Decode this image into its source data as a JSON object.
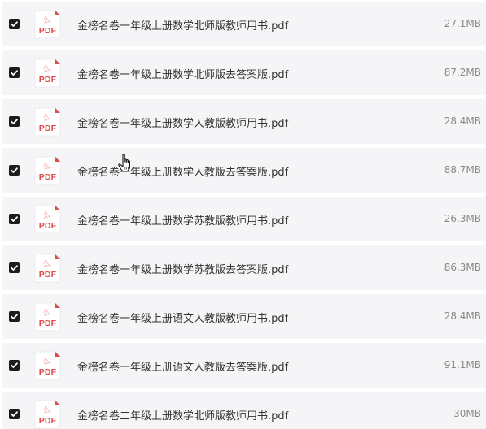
{
  "files": [
    {
      "name": "金榜名卷一年级上册数学北师版教师用书.pdf",
      "size": "27.1MB",
      "checked": true,
      "icon": "pdf-icon",
      "icon_label": "PDF"
    },
    {
      "name": "金榜名卷一年级上册数学北师版去答案版.pdf",
      "size": "87.2MB",
      "checked": true,
      "icon": "pdf-icon",
      "icon_label": "PDF"
    },
    {
      "name": "金榜名卷一年级上册数学人教版教师用书.pdf",
      "size": "28.4MB",
      "checked": true,
      "icon": "pdf-icon",
      "icon_label": "PDF"
    },
    {
      "name": "金榜名卷一年级上册数学人教版去答案版.pdf",
      "size": "88.7MB",
      "checked": true,
      "icon": "pdf-icon",
      "icon_label": "PDF"
    },
    {
      "name": "金榜名卷一年级上册数学苏教版教师用书.pdf",
      "size": "26.3MB",
      "checked": true,
      "icon": "pdf-icon",
      "icon_label": "PDF"
    },
    {
      "name": "金榜名卷一年级上册数学苏教版去答案版.pdf",
      "size": "86.3MB",
      "checked": true,
      "icon": "pdf-icon",
      "icon_label": "PDF"
    },
    {
      "name": "金榜名卷一年级上册语文人教版教师用书.pdf",
      "size": "28.4MB",
      "checked": true,
      "icon": "pdf-icon",
      "icon_label": "PDF"
    },
    {
      "name": "金榜名卷一年级上册语文人教版去答案版.pdf",
      "size": "91.1MB",
      "checked": true,
      "icon": "pdf-icon",
      "icon_label": "PDF"
    },
    {
      "name": "金榜名卷二年级上册数学北师版教师用书.pdf",
      "size": "30MB",
      "checked": true,
      "icon": "pdf-icon",
      "icon_label": "PDF"
    }
  ],
  "colors": {
    "row_background": "#f5f5f7",
    "checkbox": "#1c1c1c",
    "pdf_accent": "#e04a48",
    "file_name": "#333333",
    "file_size": "#888888"
  },
  "cursor": {
    "icon": "hand-pointer-icon"
  }
}
